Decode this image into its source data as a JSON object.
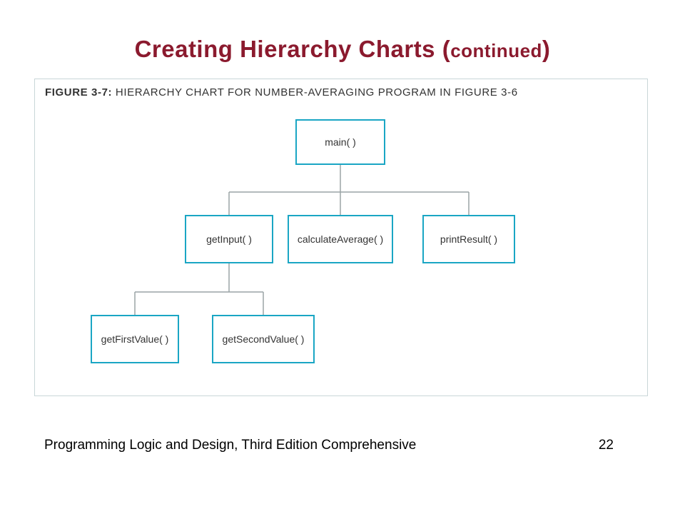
{
  "title_main": "Creating Hierarchy Charts (",
  "title_sub": "continued",
  "title_close": ")",
  "figure": {
    "label": "FIGURE 3-7:",
    "caption": " HIERARCHY CHART FOR NUMBER-AVERAGING PROGRAM IN FIGURE 3-6"
  },
  "nodes": {
    "main": "main( )",
    "getInput": "getInput( )",
    "calculateAverage": "calculateAverage( )",
    "printResult": "printResult( )",
    "getFirstValue": "getFirstValue( )",
    "getSecondValue": "getSecondValue( )"
  },
  "footer": {
    "source": "Programming Logic and Design, Third Edition Comprehensive",
    "page": "22"
  },
  "chart_data": {
    "type": "tree",
    "title": "Hierarchy Chart for Number-Averaging Program in Figure 3-6",
    "root": "main( )",
    "edges": [
      [
        "main( )",
        "getInput( )"
      ],
      [
        "main( )",
        "calculateAverage( )"
      ],
      [
        "main( )",
        "printResult( )"
      ],
      [
        "getInput( )",
        "getFirstValue( )"
      ],
      [
        "getInput( )",
        "getSecondValue( )"
      ]
    ]
  }
}
